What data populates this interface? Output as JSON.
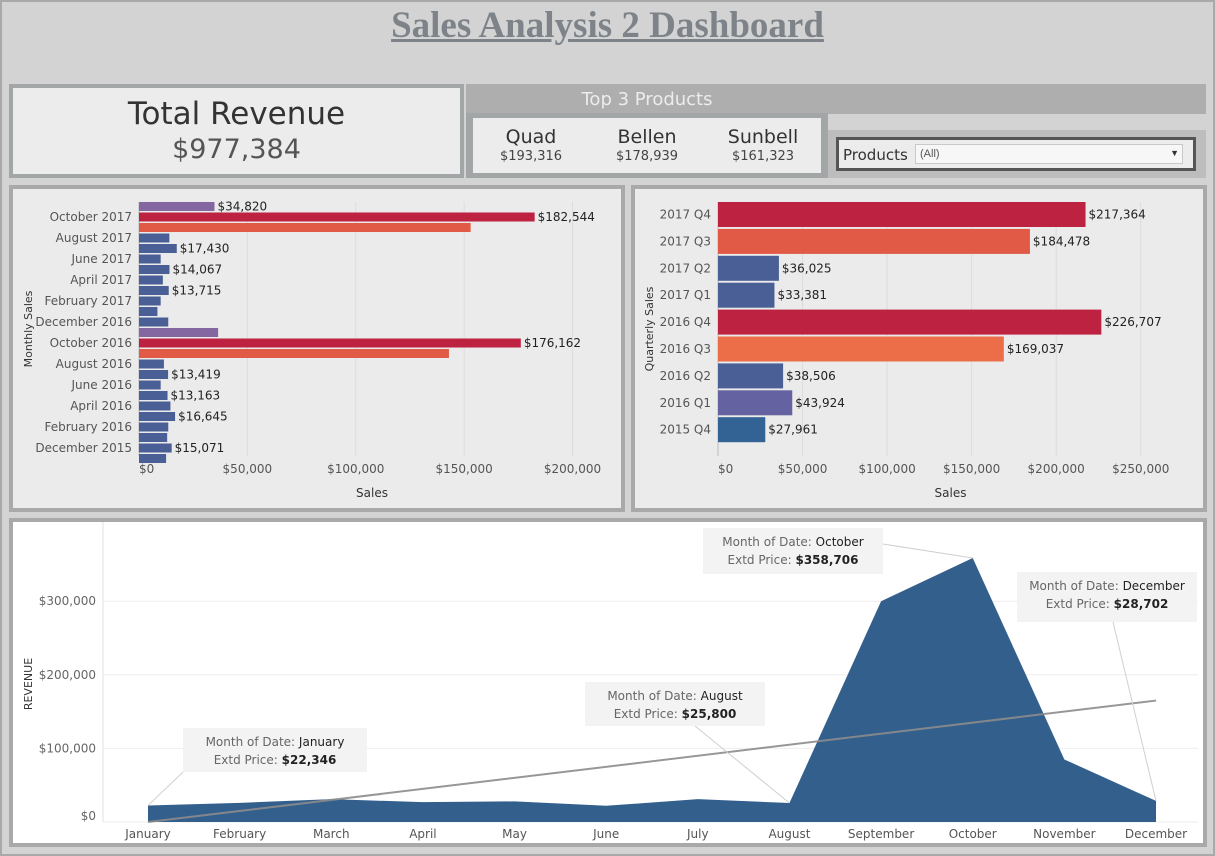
{
  "header": {
    "title": "Sales Analysis 2 Dashboard"
  },
  "kpi": {
    "label": "Total Revenue",
    "value": "$977,384"
  },
  "top_products": {
    "title": "Top 3 Products",
    "items": [
      {
        "name": "Quad",
        "value": "$193,316"
      },
      {
        "name": "Bellen",
        "value": "$178,939"
      },
      {
        "name": "Sunbell",
        "value": "$161,323"
      }
    ]
  },
  "filter": {
    "label": "Products",
    "selected": "(All)"
  },
  "colors": {
    "dark_red": "#bd2240",
    "coral": "#e05a45",
    "orange": "#ec6e48",
    "blue": "#4a5f95",
    "purple": "#8466a0",
    "violet": "#6462a0",
    "navy": "#336295",
    "area": "#335f8d",
    "trend": "#8c8c8c"
  },
  "chart_data": [
    {
      "type": "bar",
      "orientation": "horizontal",
      "title": "",
      "xlabel": "Sales",
      "ylabel": "Monthly Sales",
      "xlim": [
        0,
        215000
      ],
      "ticks": [
        "$0",
        "$50,000",
        "$100,000",
        "$150,000",
        "$200,000"
      ],
      "tick_values": [
        0,
        50000,
        100000,
        150000,
        200000
      ],
      "rows": [
        {
          "label": "",
          "value": 34820,
          "text": "$34,820",
          "color": "purple"
        },
        {
          "label": "October 2017",
          "value": 182544,
          "text": "$182,544",
          "color": "dark_red"
        },
        {
          "label": "",
          "value": 153000,
          "text": "",
          "color": "coral"
        },
        {
          "label": "August 2017",
          "value": 14000,
          "text": "",
          "color": "blue"
        },
        {
          "label": "",
          "value": 17430,
          "text": "$17,430",
          "color": "blue"
        },
        {
          "label": "June 2017",
          "value": 10000,
          "text": "",
          "color": "blue"
        },
        {
          "label": "",
          "value": 14067,
          "text": "$14,067",
          "color": "blue"
        },
        {
          "label": "April 2017",
          "value": 11000,
          "text": "",
          "color": "blue"
        },
        {
          "label": "",
          "value": 13715,
          "text": "$13,715",
          "color": "blue"
        },
        {
          "label": "February 2017",
          "value": 10000,
          "text": "",
          "color": "blue"
        },
        {
          "label": "",
          "value": 8500,
          "text": "",
          "color": "blue"
        },
        {
          "label": "December 2016",
          "value": 13500,
          "text": "",
          "color": "blue"
        },
        {
          "label": "",
          "value": 36500,
          "text": "",
          "color": "purple"
        },
        {
          "label": "October 2016",
          "value": 176162,
          "text": "$176,162",
          "color": "dark_red"
        },
        {
          "label": "",
          "value": 143000,
          "text": "",
          "color": "coral"
        },
        {
          "label": "August 2016",
          "value": 11500,
          "text": "",
          "color": "blue"
        },
        {
          "label": "",
          "value": 13419,
          "text": "$13,419",
          "color": "blue"
        },
        {
          "label": "June 2016",
          "value": 10000,
          "text": "",
          "color": "blue"
        },
        {
          "label": "",
          "value": 13163,
          "text": "$13,163",
          "color": "blue"
        },
        {
          "label": "April 2016",
          "value": 14500,
          "text": "",
          "color": "blue"
        },
        {
          "label": "",
          "value": 16645,
          "text": "$16,645",
          "color": "blue"
        },
        {
          "label": "February 2016",
          "value": 13500,
          "text": "",
          "color": "blue"
        },
        {
          "label": "",
          "value": 13000,
          "text": "",
          "color": "blue"
        },
        {
          "label": "December 2015",
          "value": 15071,
          "text": "$15,071",
          "color": "blue"
        },
        {
          "label": "",
          "value": 12500,
          "text": "",
          "color": "blue"
        }
      ]
    },
    {
      "type": "bar",
      "orientation": "horizontal",
      "title": "",
      "xlabel": "Sales",
      "ylabel": "Quarterly Sales",
      "xlim": [
        0,
        275000
      ],
      "ticks": [
        "$0",
        "$50,000",
        "$100,000",
        "$150,000",
        "$200,000",
        "$250,000"
      ],
      "tick_values": [
        0,
        50000,
        100000,
        150000,
        200000,
        250000
      ],
      "rows": [
        {
          "label": "2017 Q4",
          "value": 217364,
          "text": "$217,364",
          "color": "dark_red"
        },
        {
          "label": "2017 Q3",
          "value": 184478,
          "text": "$184,478",
          "color": "coral"
        },
        {
          "label": "2017 Q2",
          "value": 36025,
          "text": "$36,025",
          "color": "blue"
        },
        {
          "label": "2017 Q1",
          "value": 33381,
          "text": "$33,381",
          "color": "blue"
        },
        {
          "label": "2016 Q4",
          "value": 226707,
          "text": "$226,707",
          "color": "dark_red"
        },
        {
          "label": "2016 Q3",
          "value": 169037,
          "text": "$169,037",
          "color": "orange"
        },
        {
          "label": "2016 Q2",
          "value": 38506,
          "text": "$38,506",
          "color": "blue"
        },
        {
          "label": "2016 Q1",
          "value": 43924,
          "text": "$43,924",
          "color": "violet"
        },
        {
          "label": "2015 Q4",
          "value": 27961,
          "text": "$27,961",
          "color": "navy"
        }
      ]
    },
    {
      "type": "area",
      "title": "",
      "xlabel": "",
      "ylabel": "REVENUE",
      "ylim": [
        0,
        375000
      ],
      "ticks": [
        "$0",
        "$100,000",
        "$200,000",
        "$300,000"
      ],
      "tick_values": [
        0,
        100000,
        200000,
        300000
      ],
      "categories": [
        "January",
        "February",
        "March",
        "April",
        "May",
        "June",
        "July",
        "August",
        "September",
        "October",
        "November",
        "December"
      ],
      "values": [
        22346,
        26000,
        31000,
        27000,
        28000,
        22000,
        31000,
        25800,
        300000,
        358706,
        85000,
        28702
      ],
      "trend_line": {
        "start": 0,
        "end": 165000
      },
      "annotations": [
        {
          "index": 0,
          "prefix": "Month of Date: ",
          "month": "January",
          "price_prefix": "Extd Price: ",
          "price": "$22,346"
        },
        {
          "index": 7,
          "prefix": "Month of Date: ",
          "month": "August",
          "price_prefix": "Extd Price: ",
          "price": "$25,800"
        },
        {
          "index": 9,
          "prefix": "Month of Date: ",
          "month": "October",
          "price_prefix": "Extd Price: ",
          "price": "$358,706"
        },
        {
          "index": 11,
          "prefix": "Month of Date: ",
          "month": "December",
          "price_prefix": "Extd Price: ",
          "price": "$28,702"
        }
      ]
    }
  ]
}
